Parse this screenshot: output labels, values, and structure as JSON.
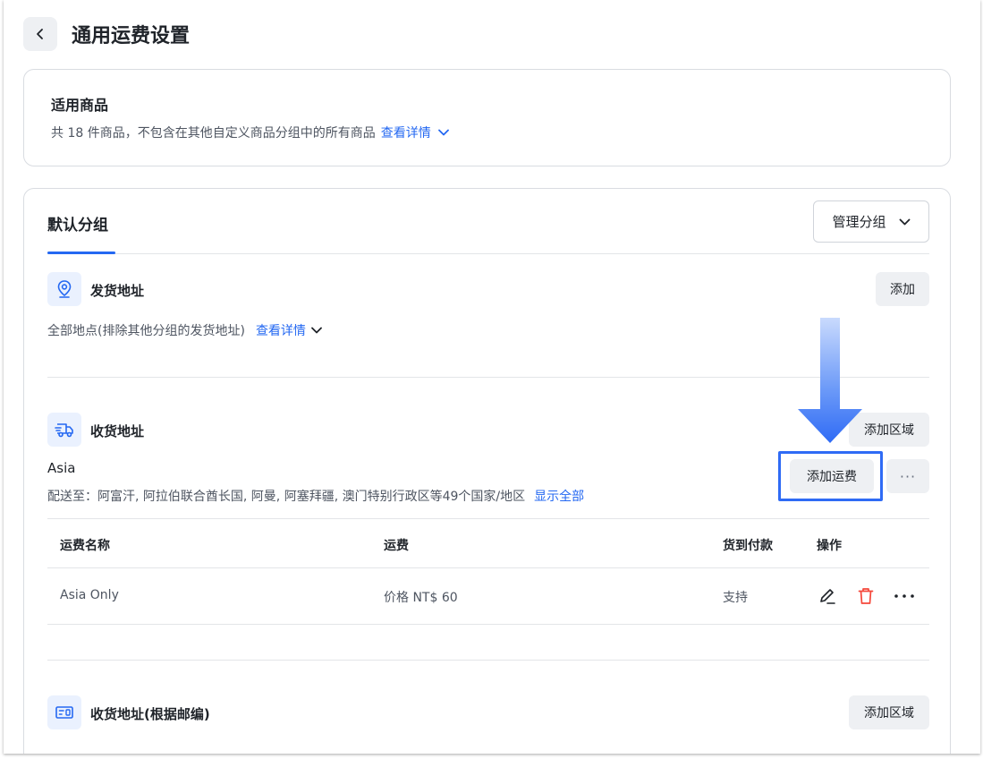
{
  "header": {
    "title": "通用运费设置"
  },
  "products_card": {
    "title": "适用商品",
    "description": "共 18 件商品，不包含在其他自定义商品分组中的所有商品",
    "details_link": "查看详情"
  },
  "group_card": {
    "tab_label": "默认分组",
    "manage_button": "管理分组",
    "ship_from": {
      "title": "发货地址",
      "add_button": "添加",
      "description": "全部地点(排除其他分组的发货地址)",
      "details_link": "查看详情"
    },
    "ship_to": {
      "title": "收货地址",
      "add_region_button": "添加区域",
      "region_name": "Asia",
      "region_desc": "配送至：阿富汗, 阿拉伯联合酋长国, 阿曼, 阿塞拜疆, 澳门特别行政区等49个国家/地区",
      "show_all_link": "显示全部",
      "add_fee_button": "添加运费",
      "more_button": "···",
      "table": {
        "headers": [
          "运费名称",
          "运费",
          "货到付款",
          "操作"
        ],
        "rows": [
          {
            "name": "Asia Only",
            "fee": "价格 NT$ 60",
            "cod": "支持"
          }
        ]
      }
    },
    "ship_to_postal": {
      "title": "收货地址(根据邮编)",
      "add_region_button": "添加区域"
    }
  },
  "colors": {
    "accent": "#2468f2",
    "highlight": "#2f6bf5",
    "danger": "#f5483b",
    "icon_bg": "#eaf1fe",
    "button_bg": "#eef0f3"
  },
  "icons": [
    "chevron-left-icon",
    "chevron-down-icon",
    "location-pin-icon",
    "truck-icon",
    "postal-card-icon",
    "edit-icon",
    "trash-icon",
    "more-icon",
    "arrow-down-icon"
  ]
}
